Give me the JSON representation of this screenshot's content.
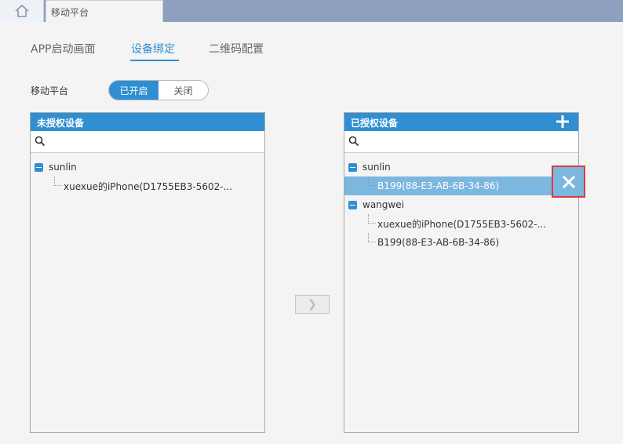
{
  "topbar": {
    "home_icon": "home-icon",
    "tab_label": "移动平台"
  },
  "subtabs": [
    {
      "label": "APP启动画面",
      "active": false
    },
    {
      "label": "设备绑定",
      "active": true
    },
    {
      "label": "二维码配置",
      "active": false
    }
  ],
  "platform": {
    "label": "移动平台",
    "on_label": "已开启",
    "off_label": "关闭",
    "value": "on"
  },
  "unauthorized": {
    "title": "未授权设备",
    "search_placeholder": "",
    "tree": [
      {
        "user": "sunlin",
        "devices": [
          "xuexue的iPhone(D1755EB3-5602-..."
        ]
      }
    ]
  },
  "authorized": {
    "title": "已授权设备",
    "search_placeholder": "",
    "tree": [
      {
        "user": "sunlin",
        "devices": [
          "B199(88-E3-AB-6B-34-86)"
        ]
      },
      {
        "user": "wangwei",
        "devices": [
          "xuexue的iPhone(D1755EB3-5602-...",
          "B199(88-E3-AB-6B-34-86)"
        ]
      }
    ]
  },
  "move_button": "❯",
  "colors": {
    "accent": "#2f8fd2",
    "selected_row": "#7cb7e0",
    "highlight_border": "#e03a3a"
  }
}
